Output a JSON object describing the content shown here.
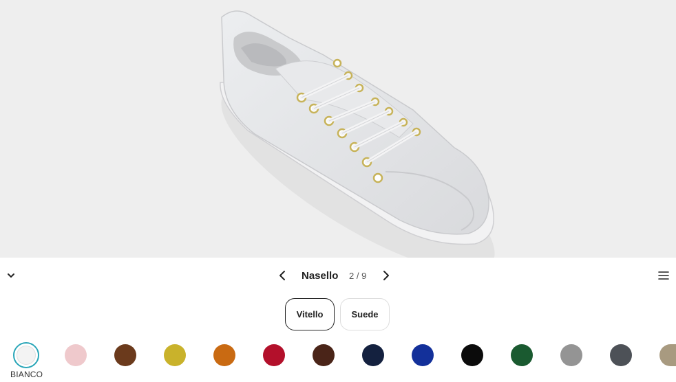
{
  "toolbar": {
    "collapse_icon": "chevron-down-icon",
    "part_name": "Nasello",
    "counter": "2 / 9",
    "prev_icon": "chevron-left-icon",
    "next_icon": "chevron-right-icon",
    "menu_icon": "hamburger-menu-icon"
  },
  "materials": [
    {
      "label": "Vitello",
      "selected": true
    },
    {
      "label": "Suede",
      "selected": false
    }
  ],
  "swatches": {
    "selected_label": "BIANCO",
    "colors": [
      "#f3f3f3",
      "#efc9cc",
      "#6b3a1c",
      "#c9b22b",
      "#c96a12",
      "#b3102b",
      "#4a2418",
      "#14213f",
      "#13309a",
      "#0b0b0b",
      "#1a5a30",
      "#949494",
      "#4d5157",
      "#a89a80"
    ]
  },
  "viewer": {
    "background": "#eeeeee",
    "shoe_color": "#e3e4e7"
  }
}
